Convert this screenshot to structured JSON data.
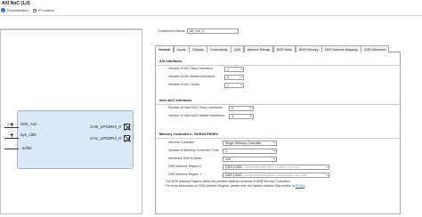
{
  "window": {
    "title": "AXI NoC (1.0)"
  },
  "topbar": {
    "documentation_label": "Documentation",
    "ip_location_label": "IP Location"
  },
  "diagram": {
    "left_ports": [
      "S00_AXI",
      "sys_clk0",
      "aclk0"
    ],
    "right_ports": [
      "CH0_LPDDR4_0",
      "CH1_LPDDR4_0"
    ]
  },
  "config": {
    "component_name_label": "Component Name",
    "component_name_value": "axi_noc_0",
    "tabs": [
      "General",
      "Inputs",
      "Outputs",
      "Connectivity",
      "QoS",
      "Address Remap",
      "DDR Basic",
      "DDR Memory",
      "DDR Address Mapping",
      "DDR Advanced"
    ],
    "axi": {
      "heading": "AXI Interfaces",
      "rows": [
        {
          "label": "Number of AXI Slave Interfaces",
          "value": "1"
        },
        {
          "label": "Number of AXI Master Interfaces",
          "value": "0"
        },
        {
          "label": "Number of AXI Clocks",
          "value": "1"
        }
      ]
    },
    "inter": {
      "heading": "Inter-NoC Interfaces",
      "rows": [
        {
          "label": "Number of Inter-NOC Slave Interfaces",
          "value": "0"
        },
        {
          "label": "Number of Inter-NOC Master Interfaces",
          "value": "0"
        }
      ]
    },
    "mem": {
      "heading": "Memory Controllers - DDR4/LPDDR4",
      "rows": [
        {
          "label": "Memory Controller",
          "value": "Single Memory Controller"
        },
        {
          "label": "Number of Memory Controller Ports",
          "value": "1"
        },
        {
          "label": "Interleave Size in Bytes",
          "value": "128"
        },
        {
          "label": "DDR Address Region 0",
          "value": "DDR LOW0",
          "range": "0x00000000 0000 0000 to 0x0000 7FFF FFFF"
        },
        {
          "label": "DDR Address Region 1",
          "value": "DDR LOW1",
          "range": "0x0000 0008 0000 0000 to 0x0000 000F FFFF FFFF"
        }
      ],
      "note_line1": "The DDR Address Regions define the possible address locations of DDR Memory Controllers",
      "note_line2_prefix": "For more information on DDR Address Regions, please refer the System Address Map section in",
      "note_link": "PG313"
    }
  },
  "colors": {
    "accent": "#2f63b8",
    "ip_block_fill": "#dbe8f5",
    "ip_block_border": "#9fb6d2"
  }
}
